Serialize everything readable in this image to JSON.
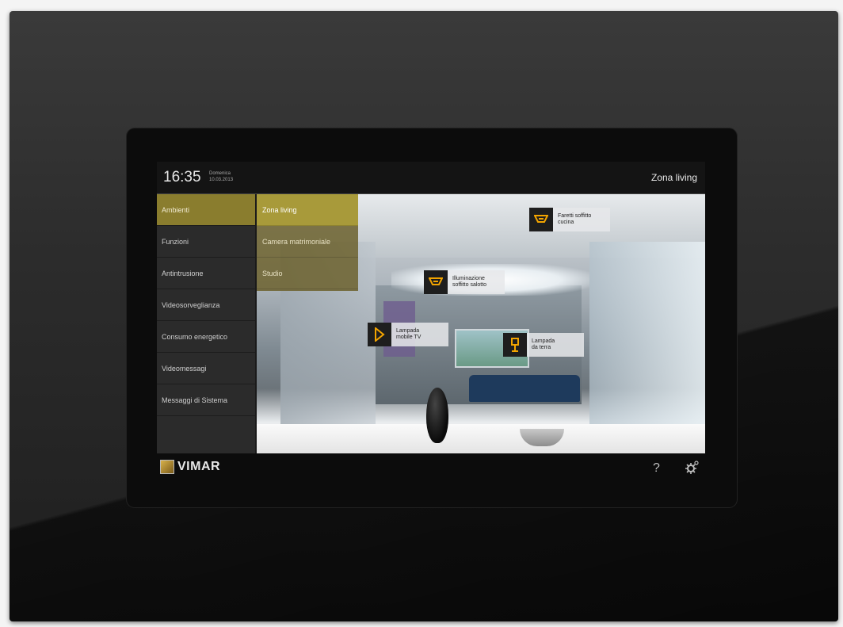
{
  "header": {
    "time": "16:35",
    "day": "Domenica",
    "date": "10.03.2013",
    "zone_title": "Zona living"
  },
  "menu": {
    "items": [
      {
        "label": "Ambienti",
        "active": true
      },
      {
        "label": "Funzioni",
        "active": false
      },
      {
        "label": "Antintrusione",
        "active": false
      },
      {
        "label": "Videosorveglianza",
        "active": false
      },
      {
        "label": "Consumo energetico",
        "active": false
      },
      {
        "label": "Videomessagi",
        "active": false
      },
      {
        "label": "Messaggi di Sistema",
        "active": false
      }
    ]
  },
  "submenu": {
    "items": [
      {
        "label": "Zona living",
        "active": true
      },
      {
        "label": "Camera matrimoniale",
        "active": false
      },
      {
        "label": "Studio",
        "active": false
      }
    ]
  },
  "room_devices": [
    {
      "icon": "ceiling-spotlight-icon",
      "line1": "Faretti soffitto",
      "line2": "cucina"
    },
    {
      "icon": "ceiling-light-icon",
      "line1": "Illuminazione",
      "line2": "soffitto salotto"
    },
    {
      "icon": "wall-lamp-icon",
      "line1": "Lampada",
      "line2": "mobile TV"
    },
    {
      "icon": "floor-lamp-icon",
      "line1": "Lampada",
      "line2": "da terra"
    }
  ],
  "footer": {
    "brand": "VIMAR",
    "help_symbol": "?",
    "settings_icon": "gear-icon"
  },
  "colors": {
    "accent": "#8a7d2e",
    "icon_orange": "#f2a400",
    "screen_bg": "#1a1a1a"
  }
}
